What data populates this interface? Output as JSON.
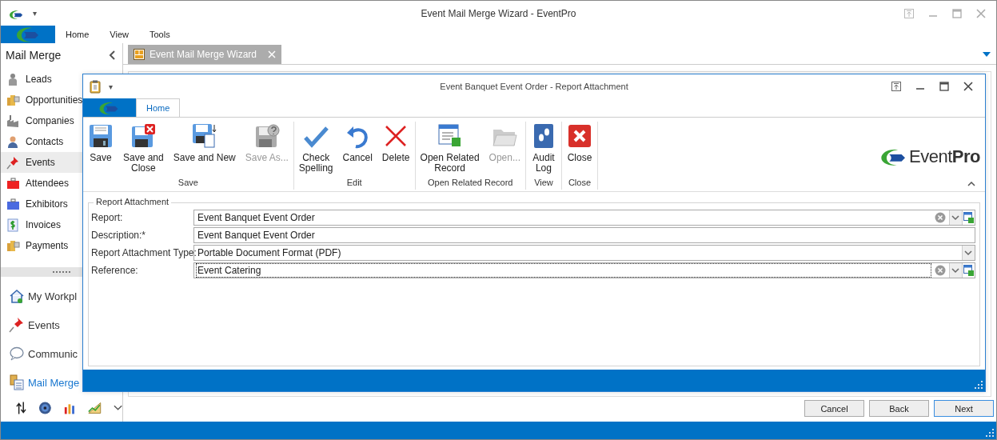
{
  "window": {
    "title": "Event Mail Merge Wizard - EventPro",
    "menu_glyph": "▾"
  },
  "ribbon_tabs": [
    {
      "label": "Home",
      "selected": false
    },
    {
      "label": "View",
      "selected": false
    },
    {
      "label": "Tools",
      "selected": false
    }
  ],
  "sidebar": {
    "title": "Mail Merge",
    "items": [
      {
        "label": "Leads",
        "selected": false
      },
      {
        "label": "Opportunities",
        "selected": false
      },
      {
        "label": "Companies",
        "selected": false
      },
      {
        "label": "Contacts",
        "selected": false
      },
      {
        "label": "Events",
        "selected": true
      },
      {
        "label": "Attendees",
        "selected": false
      },
      {
        "label": "Exhibitors",
        "selected": false
      },
      {
        "label": "Invoices",
        "selected": false
      },
      {
        "label": "Payments",
        "selected": false
      }
    ],
    "nav": [
      {
        "label": "My Workpl",
        "selected": false
      },
      {
        "label": "Events",
        "selected": false
      },
      {
        "label": "Communic",
        "selected": false
      },
      {
        "label": "Mail Merge",
        "selected": true
      }
    ]
  },
  "document_tab": {
    "label": "Event Mail Merge Wizard"
  },
  "wizard_buttons": [
    {
      "label": "Cancel",
      "focused": false
    },
    {
      "label": "Back",
      "focused": false
    },
    {
      "label": "Next",
      "focused": true
    }
  ],
  "dialog": {
    "title": "Event Banquet Event Order - Report Attachment",
    "menu_glyph": "▾",
    "ribbon_tabs": [
      {
        "label": "Home",
        "selected": true
      }
    ],
    "groups": [
      {
        "label": "Save",
        "buttons": [
          {
            "label": "Save",
            "disabled": false
          },
          {
            "label": "Save and\nClose",
            "disabled": false
          },
          {
            "label": "Save and New",
            "disabled": false
          },
          {
            "label": "Save As...",
            "disabled": true
          }
        ]
      },
      {
        "label": "Edit",
        "buttons": [
          {
            "label": "Check\nSpelling",
            "disabled": false
          },
          {
            "label": "Cancel",
            "disabled": false
          },
          {
            "label": "Delete",
            "disabled": false
          }
        ]
      },
      {
        "label": "Open Related Record",
        "buttons": [
          {
            "label": "Open Related\nRecord",
            "disabled": false
          },
          {
            "label": "Open...",
            "disabled": true
          }
        ]
      },
      {
        "label": "View",
        "buttons": [
          {
            "label": "Audit\nLog",
            "disabled": false
          }
        ]
      },
      {
        "label": "Close",
        "buttons": [
          {
            "label": "Close",
            "disabled": false
          }
        ]
      }
    ],
    "logo": "Event**Pro**",
    "form": {
      "legend": "Report Attachment",
      "fields": [
        {
          "label": "Report:",
          "value": "Event Banquet Event Order",
          "kind": "lookup",
          "focused": false
        },
        {
          "label": "Description:*",
          "value": "Event Banquet Event Order",
          "kind": "text",
          "focused": false
        },
        {
          "label": "Report Attachment Type:",
          "value": "Portable Document Format (PDF)",
          "kind": "dropdown",
          "focused": false
        },
        {
          "label": "Reference:",
          "value": "Event Catering",
          "kind": "lookup",
          "focused": true
        }
      ]
    }
  }
}
